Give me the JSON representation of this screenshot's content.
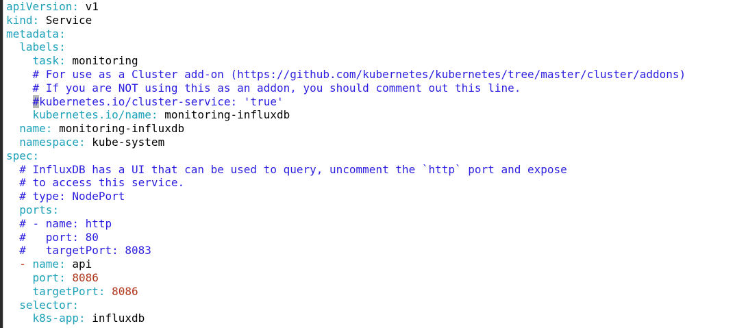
{
  "colors": {
    "key": "#1ba1b8",
    "comment": "#2a1ce0",
    "number": "#b0341a",
    "value": "#000000",
    "background": "#ffffff"
  },
  "lines": {
    "l1": {
      "key": "apiVersion",
      "sep": ": ",
      "val": "v1"
    },
    "l2": {
      "key": "kind",
      "sep": ": ",
      "val": "Service"
    },
    "l3": {
      "key": "metadata",
      "sep": ":"
    },
    "l4": {
      "indent": "  ",
      "key": "labels",
      "sep": ":"
    },
    "l5": {
      "indent": "    ",
      "key": "task",
      "sep": ": ",
      "val": "monitoring"
    },
    "l6": {
      "indent": "    ",
      "comment": "# For use as a Cluster add-on (https://github.com/kubernetes/kubernetes/tree/master/cluster/addons)"
    },
    "l7": {
      "indent": "    ",
      "comment": "# If you are NOT using this as an addon, you should comment out this line."
    },
    "l8": {
      "indent": "    ",
      "hash": "#",
      "comment": "kubernetes.io/cluster-service: 'true'"
    },
    "l9": {
      "indent": "    ",
      "key": "kubernetes.io/name",
      "sep": ": ",
      "val": "monitoring-influxdb"
    },
    "l10": {
      "indent": "  ",
      "key": "name",
      "sep": ": ",
      "val": "monitoring-influxdb"
    },
    "l11": {
      "indent": "  ",
      "key": "namespace",
      "sep": ": ",
      "val": "kube-system"
    },
    "l12": {
      "key": "spec",
      "sep": ":"
    },
    "l13": {
      "indent": "  ",
      "comment": "# InfluxDB has a UI that can be used to query, uncomment the `http` port and expose"
    },
    "l14": {
      "indent": "  ",
      "comment": "# to access this service."
    },
    "l15": {
      "indent": "  ",
      "comment": "# type: NodePort"
    },
    "l16": {
      "indent": "  ",
      "key": "ports",
      "sep": ":"
    },
    "l17": {
      "indent": "  ",
      "comment": "# - name: http"
    },
    "l18": {
      "indent": "  ",
      "comment": "#   port: 80"
    },
    "l19": {
      "indent": "  ",
      "comment": "#   targetPort: 8083"
    },
    "l20": {
      "indent": "  ",
      "dash": "- ",
      "key": "name",
      "sep": ": ",
      "val": "api"
    },
    "l21": {
      "indent": "    ",
      "key": "port",
      "sep": ": ",
      "val": "8086"
    },
    "l22": {
      "indent": "    ",
      "key": "targetPort",
      "sep": ": ",
      "val": "8086"
    },
    "l23": {
      "indent": "  ",
      "key": "selector",
      "sep": ":"
    },
    "l24": {
      "indent": "    ",
      "key": "k8s-app",
      "sep": ": ",
      "val": "influxdb"
    }
  }
}
